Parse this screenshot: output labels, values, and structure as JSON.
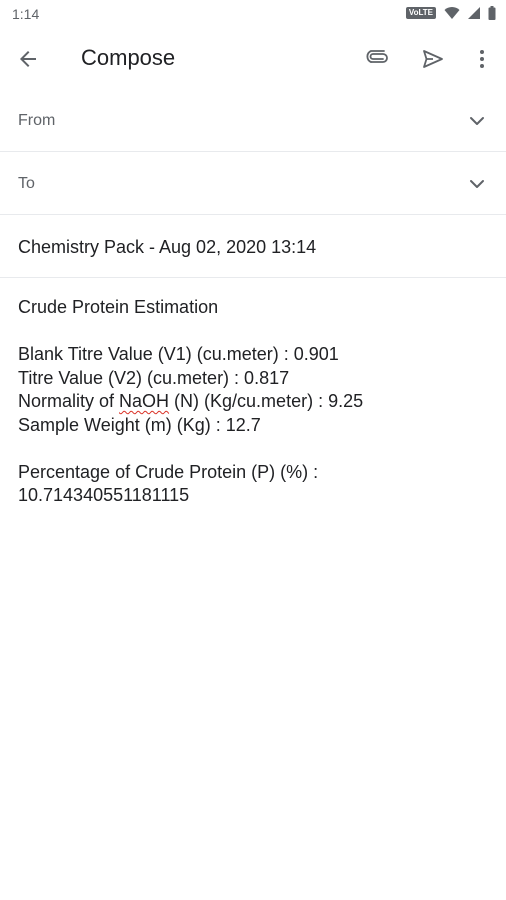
{
  "status_bar": {
    "time": "1:14",
    "network_badge": "VoLTE",
    "icons": [
      "volte-icon",
      "wifi-icon",
      "signal-icon",
      "battery-icon"
    ]
  },
  "app_bar": {
    "title": "Compose",
    "icons": [
      "back-arrow-icon",
      "attachment-icon",
      "send-icon",
      "more-vert-icon"
    ]
  },
  "fields": {
    "from_label": "From",
    "to_label": "To"
  },
  "subject": "Chemistry Pack - Aug 02, 2020 13:14",
  "body": {
    "heading": "Crude Protein Estimation",
    "line1": "Blank Titre Value (V1) (cu.meter) : 0.901",
    "line2": "Titre Value (V2) (cu.meter) : 0.817",
    "line3_before": "Normality of ",
    "line3_flagged": "NaOH",
    "line3_after": " (N) (Kg/cu.meter) : 9.25",
    "line4": "Sample Weight (m) (Kg) : 12.7",
    "result_label": "Percentage of Crude Protein (P) (%) :",
    "result_value": "10.714340551181115"
  },
  "colors": {
    "text_primary": "#202124",
    "text_secondary": "#5f6368",
    "divider": "#e8eaed",
    "spellcheck": "#d93025"
  }
}
